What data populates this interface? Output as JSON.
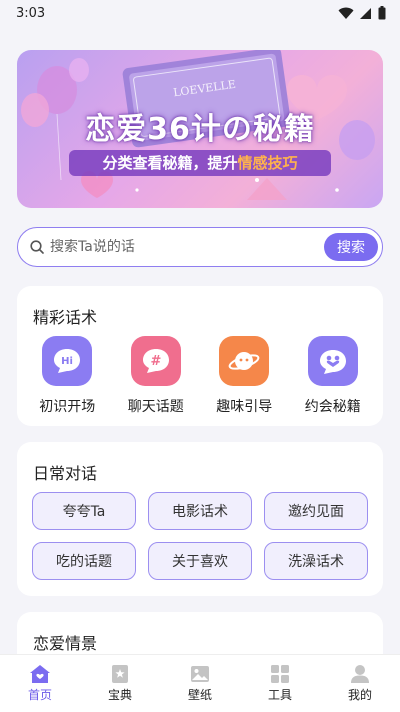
{
  "status_bar": {
    "time": "3:03"
  },
  "banner": {
    "title": "恋爱36计の秘籍",
    "subtitle_prefix": "分类查看秘籍，提升",
    "subtitle_highlight": "情感技巧",
    "book_text": "LOEVELLE"
  },
  "search": {
    "placeholder": "搜索Ta说的话",
    "button_label": "搜索"
  },
  "featured": {
    "title": "精彩话术",
    "items": [
      {
        "label": "初识开场",
        "icon": "hi-chat-icon",
        "color": "#8b7cf2"
      },
      {
        "label": "聊天话题",
        "icon": "hashtag-chat-icon",
        "color": "#f06e8e"
      },
      {
        "label": "趣味引导",
        "icon": "planet-icon",
        "color": "#f5874a"
      },
      {
        "label": "约会秘籍",
        "icon": "couple-heart-icon",
        "color": "#8b7cf2"
      }
    ]
  },
  "daily": {
    "title": "日常对话",
    "chips": [
      "夸夸Ta",
      "电影话术",
      "邀约见面",
      "吃的话题",
      "关于喜欢",
      "洗澡话术"
    ]
  },
  "love_scenes": {
    "title": "恋爱情景"
  },
  "nav": {
    "items": [
      {
        "label": "首页",
        "icon": "home-icon"
      },
      {
        "label": "宝典",
        "icon": "book-icon"
      },
      {
        "label": "壁纸",
        "icon": "image-icon"
      },
      {
        "label": "工具",
        "icon": "grid-icon"
      },
      {
        "label": "我的",
        "icon": "person-icon"
      }
    ],
    "active_color": "#6b5ae8"
  }
}
